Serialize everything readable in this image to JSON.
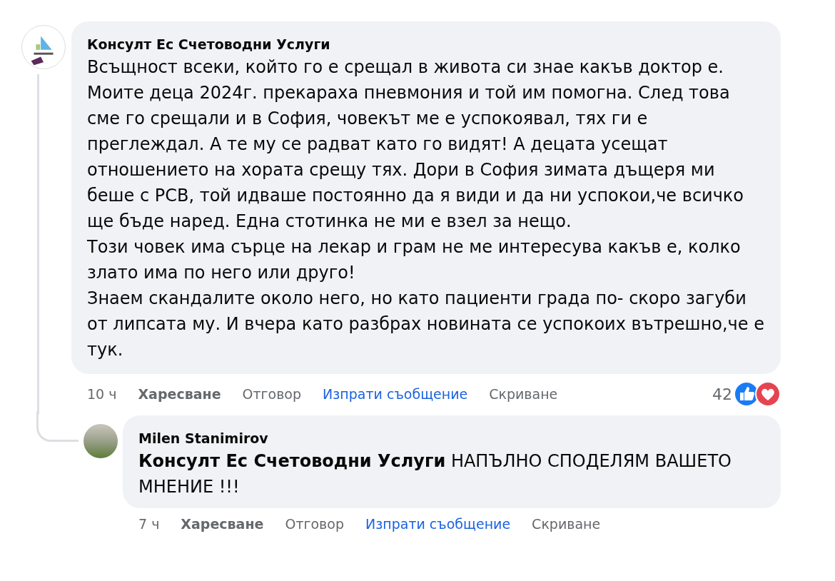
{
  "comments": [
    {
      "author": "Консулт Ес Счетоводни Услуги",
      "avatar": {
        "kind": "logo"
      },
      "paragraphs": [
        "Всъщност всеки, който го е срещал в живота си знае какъв доктор е. Моите деца 2024г. прекараха пневмония и той им помогна. След това сме го срещали и в София, човекът ме е успокоявал, тях ги е преглеждал. А те му се радват като го видят! А децата усещат отношението на хората срещу тях. Дори в София зимата дъщеря ми беше с РСВ, той идваше постоянно да я види и да ни успокои,че всичко ще бъде наред. Една стотинка не ми е взел за нещо.",
        "Този човек има сърце на лекар и грам не ме интересува какъв е, колко злато има по него или друго!",
        "Знаем скандалите около него, но като пациенти града по- скоро загуби от липсата му. И вчера като разбрах новината се успокоих вътрешно,че е тук."
      ],
      "time": "10 ч",
      "actions": [
        {
          "label": "Харесване",
          "kind": "bold"
        },
        {
          "label": "Отговор",
          "kind": "plain"
        },
        {
          "label": "Изпрати съобщение",
          "kind": "link"
        },
        {
          "label": "Скриване",
          "kind": "plain"
        }
      ],
      "reactions": {
        "count": "42",
        "types": [
          {
            "kind": "like"
          },
          {
            "kind": "love"
          }
        ]
      },
      "replies": [
        {
          "author": "Milen Stanimirov",
          "avatar": {
            "kind": "photo"
          },
          "paragraphs": [
            "**Консулт Ес Счетоводни Услуги** НАПЪЛНО СПОДЕЛЯМ ВАШЕТО МНЕНИЕ !!!"
          ],
          "time": "7 ч",
          "actions": [
            {
              "label": "Харесване",
              "kind": "bold"
            },
            {
              "label": "Отговор",
              "kind": "plain"
            },
            {
              "label": "Изпрати съобщение",
              "kind": "link"
            },
            {
              "label": "Скриване",
              "kind": "plain"
            }
          ]
        }
      ]
    }
  ]
}
